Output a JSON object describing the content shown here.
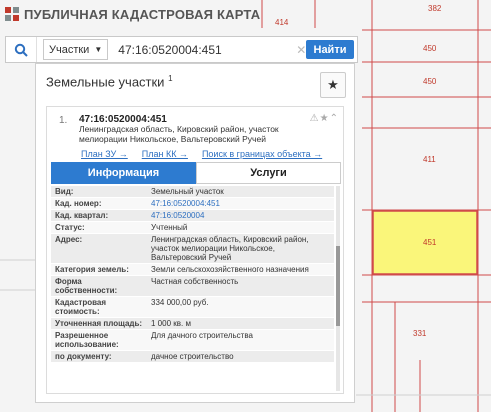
{
  "app": {
    "title": "ПУБЛИЧНАЯ КАДАСТРОВАЯ КАРТА"
  },
  "search": {
    "type_label": "Участки",
    "query": "47:16:0520004:451",
    "find_label": "Найти"
  },
  "panel": {
    "title": "Земельные участки",
    "title_count": "1"
  },
  "card": {
    "index": "1.",
    "cadnum": "47:16:0520004:451",
    "address": "Ленинградская область, Кировский район, участок мелиорации Никольское, Вальтеровский Ручей",
    "links": [
      "План ЗУ →",
      "План КК →",
      "Поиск в границах объекта →"
    ],
    "tabs": [
      "Информация",
      "Услуги"
    ]
  },
  "info_rows": [
    {
      "key": "Вид:",
      "value": "Земельный участок"
    },
    {
      "key": "Кад. номер:",
      "value": "47:16:0520004:451"
    },
    {
      "key": "Кад. квартал:",
      "value": "47:16:0520004"
    },
    {
      "key": "Статус:",
      "value": "Учтенный"
    },
    {
      "key": "Адрес:",
      "value": "Ленинградская область, Кировский район, участок мелиорации Никольское, Вальтеровский Ручей"
    },
    {
      "key": "Категория земель:",
      "value": "Земли сельскохозяйственного назначения"
    },
    {
      "key": "Форма собственности:",
      "value": "Частная собственность"
    },
    {
      "key": "Кадастровая стоимость:",
      "value": "334 000,00 руб."
    },
    {
      "key": "Уточненная площадь:",
      "value": "1 000 кв. м"
    },
    {
      "key": "Разрешенное использование:",
      "value": "Для дачного строительства"
    },
    {
      "key": "по документу:",
      "value": "дачное строительство"
    }
  ],
  "map_labels": [
    "382",
    "414",
    "450",
    "450",
    "411",
    "451",
    "331"
  ],
  "colors": {
    "accent": "#2d7bd0",
    "parcel_highlight": "#faf67a",
    "parcel_line": "#d04a4a"
  }
}
